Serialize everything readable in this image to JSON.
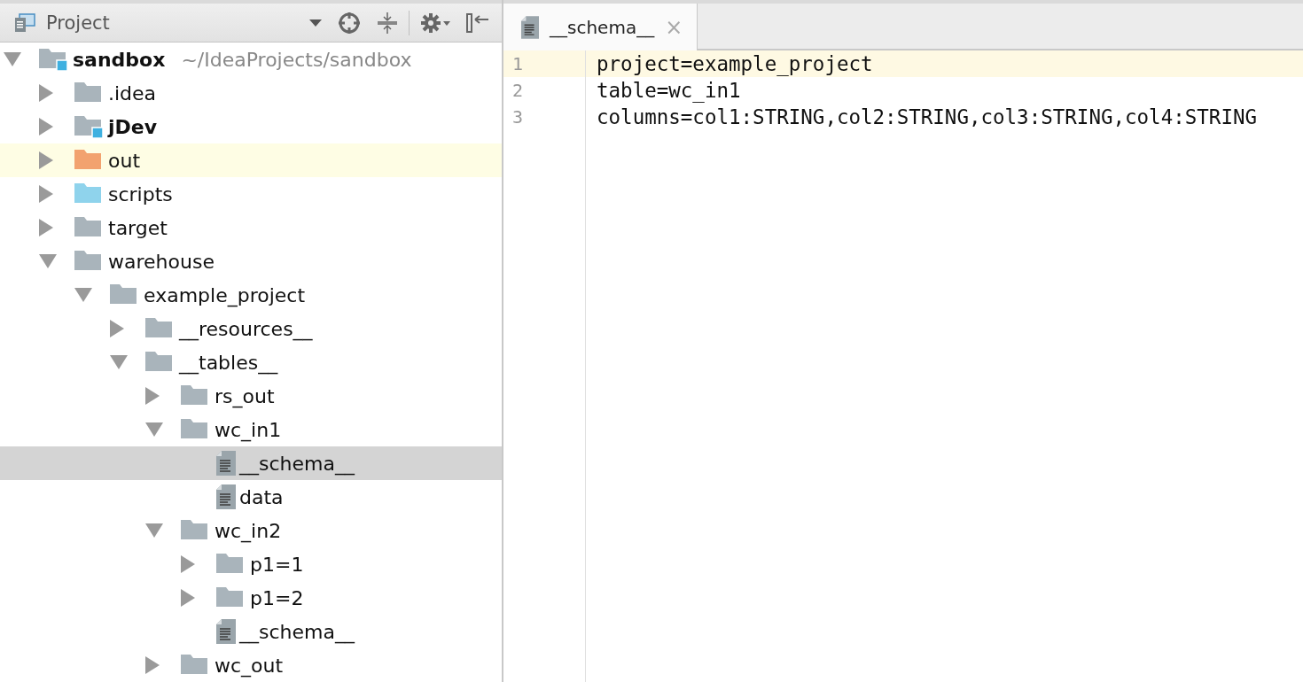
{
  "project_panel": {
    "title": "Project"
  },
  "tree": [
    {
      "name": "sandbox",
      "path": "~/IdeaProjects/sandbox",
      "kind": "module",
      "expanded": true,
      "selected": false,
      "highlighted": false,
      "children": [
        {
          "name": ".idea",
          "kind": "folder",
          "expanded": false,
          "selected": false,
          "highlighted": false
        },
        {
          "name": "jDev",
          "kind": "module",
          "expanded": false,
          "selected": false,
          "highlighted": false
        },
        {
          "name": "out",
          "kind": "excluded",
          "expanded": false,
          "selected": false,
          "highlighted": true
        },
        {
          "name": "scripts",
          "kind": "source",
          "expanded": false,
          "selected": false,
          "highlighted": false
        },
        {
          "name": "target",
          "kind": "folder",
          "expanded": false,
          "selected": false,
          "highlighted": false
        },
        {
          "name": "warehouse",
          "kind": "folder",
          "expanded": true,
          "selected": false,
          "highlighted": false,
          "children": [
            {
              "name": "example_project",
              "kind": "folder",
              "expanded": true,
              "selected": false,
              "highlighted": false,
              "children": [
                {
                  "name": "__resources__",
                  "kind": "folder",
                  "expanded": false,
                  "selected": false,
                  "highlighted": false
                },
                {
                  "name": "__tables__",
                  "kind": "folder",
                  "expanded": true,
                  "selected": false,
                  "highlighted": false,
                  "children": [
                    {
                      "name": "rs_out",
                      "kind": "folder",
                      "expanded": false,
                      "selected": false,
                      "highlighted": false
                    },
                    {
                      "name": "wc_in1",
                      "kind": "folder",
                      "expanded": true,
                      "selected": false,
                      "highlighted": false,
                      "children": [
                        {
                          "name": "__schema__",
                          "kind": "file",
                          "selected": true,
                          "highlighted": false
                        },
                        {
                          "name": "data",
                          "kind": "file",
                          "selected": false,
                          "highlighted": false
                        }
                      ]
                    },
                    {
                      "name": "wc_in2",
                      "kind": "folder",
                      "expanded": true,
                      "selected": false,
                      "highlighted": false,
                      "children": [
                        {
                          "name": "p1=1",
                          "kind": "folder",
                          "expanded": false,
                          "selected": false,
                          "highlighted": false
                        },
                        {
                          "name": "p1=2",
                          "kind": "folder",
                          "expanded": false,
                          "selected": false,
                          "highlighted": false
                        },
                        {
                          "name": "__schema__",
                          "kind": "file",
                          "selected": false,
                          "highlighted": false
                        }
                      ]
                    },
                    {
                      "name": "wc_out",
                      "kind": "folder",
                      "expanded": false,
                      "selected": false,
                      "highlighted": false
                    }
                  ]
                }
              ]
            }
          ]
        }
      ]
    }
  ],
  "editor": {
    "tabs": [
      {
        "label": "__schema__",
        "selected": true,
        "close": "×"
      }
    ],
    "lines": [
      {
        "number": "1",
        "text": "project=example_project",
        "current": true
      },
      {
        "number": "2",
        "text": "table=wc_in1",
        "current": false
      },
      {
        "number": "3",
        "text": "columns=col1:STRING,col2:STRING,col3:STRING,col4:STRING",
        "current": false
      }
    ]
  }
}
